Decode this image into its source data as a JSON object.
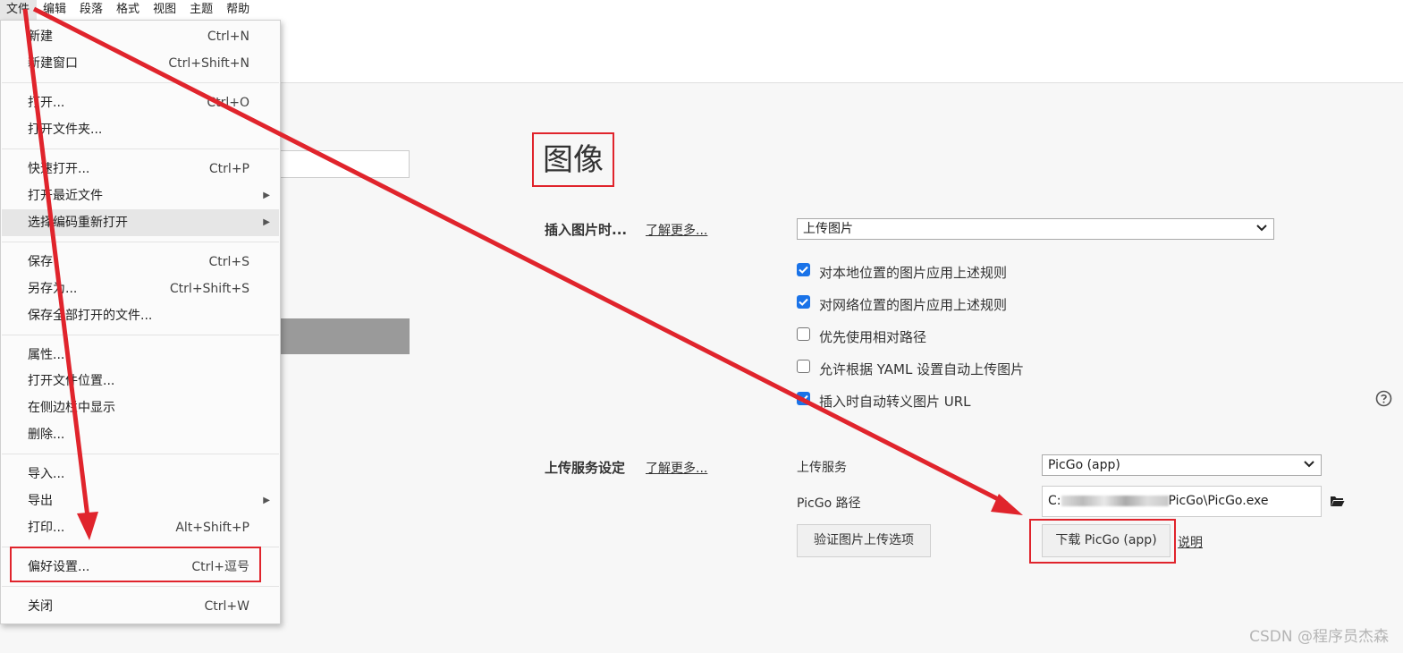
{
  "menubar": {
    "items": [
      "文件",
      "编辑",
      "段落",
      "格式",
      "视图",
      "主题",
      "帮助"
    ]
  },
  "file_menu": {
    "items": [
      {
        "label": "新建",
        "shortcut": "Ctrl+N"
      },
      {
        "label": "新建窗口",
        "shortcut": "Ctrl+Shift+N"
      },
      {
        "label": "打开...",
        "shortcut": "Ctrl+O"
      },
      {
        "label": "打开文件夹...",
        "shortcut": ""
      },
      {
        "label": "快速打开...",
        "shortcut": "Ctrl+P"
      },
      {
        "label": "打开最近文件",
        "shortcut": ""
      },
      {
        "label": "选择编码重新打开",
        "shortcut": ""
      },
      {
        "label": "保存",
        "shortcut": "Ctrl+S"
      },
      {
        "label": "另存为...",
        "shortcut": "Ctrl+Shift+S"
      },
      {
        "label": "保存全部打开的文件...",
        "shortcut": ""
      },
      {
        "label": "属性...",
        "shortcut": ""
      },
      {
        "label": "打开文件位置...",
        "shortcut": ""
      },
      {
        "label": "在侧边栏中显示",
        "shortcut": ""
      },
      {
        "label": "删除...",
        "shortcut": ""
      },
      {
        "label": "导入...",
        "shortcut": ""
      },
      {
        "label": "导出",
        "shortcut": ""
      },
      {
        "label": "打印...",
        "shortcut": "Alt+Shift+P"
      },
      {
        "label": "偏好设置...",
        "shortcut": "Ctrl+逗号"
      },
      {
        "label": "关闭",
        "shortcut": "Ctrl+W"
      }
    ]
  },
  "image_settings": {
    "title": "图像",
    "insert_label": "插入图片时...",
    "learn_more": "了解更多...",
    "insert_select": "上传图片",
    "checkboxes": [
      {
        "label": "对本地位置的图片应用上述规则",
        "checked": true
      },
      {
        "label": "对网络位置的图片应用上述规则",
        "checked": true
      },
      {
        "label": "优先使用相对路径",
        "checked": false
      },
      {
        "label": "允许根据 YAML 设置自动上传图片",
        "checked": false
      },
      {
        "label": "插入时自动转义图片 URL",
        "checked": true
      }
    ],
    "help_icon": "question-circle-icon"
  },
  "upload_settings": {
    "section_label": "上传服务设定",
    "learn_more": "了解更多...",
    "service_label": "上传服务",
    "service_value": "PicGo (app)",
    "path_label": "PicGo 路径",
    "path_prefix": "C:",
    "path_suffix": "PicGo\\PicGo.exe",
    "verify_button": "验证图片上传选项",
    "download_button": "下载 PicGo (app)",
    "explain_link": "说明"
  },
  "watermark": "CSDN @程序员杰森",
  "colors": {
    "annotation_red": "#e0242c",
    "checkbox_blue": "#1a73e8"
  }
}
